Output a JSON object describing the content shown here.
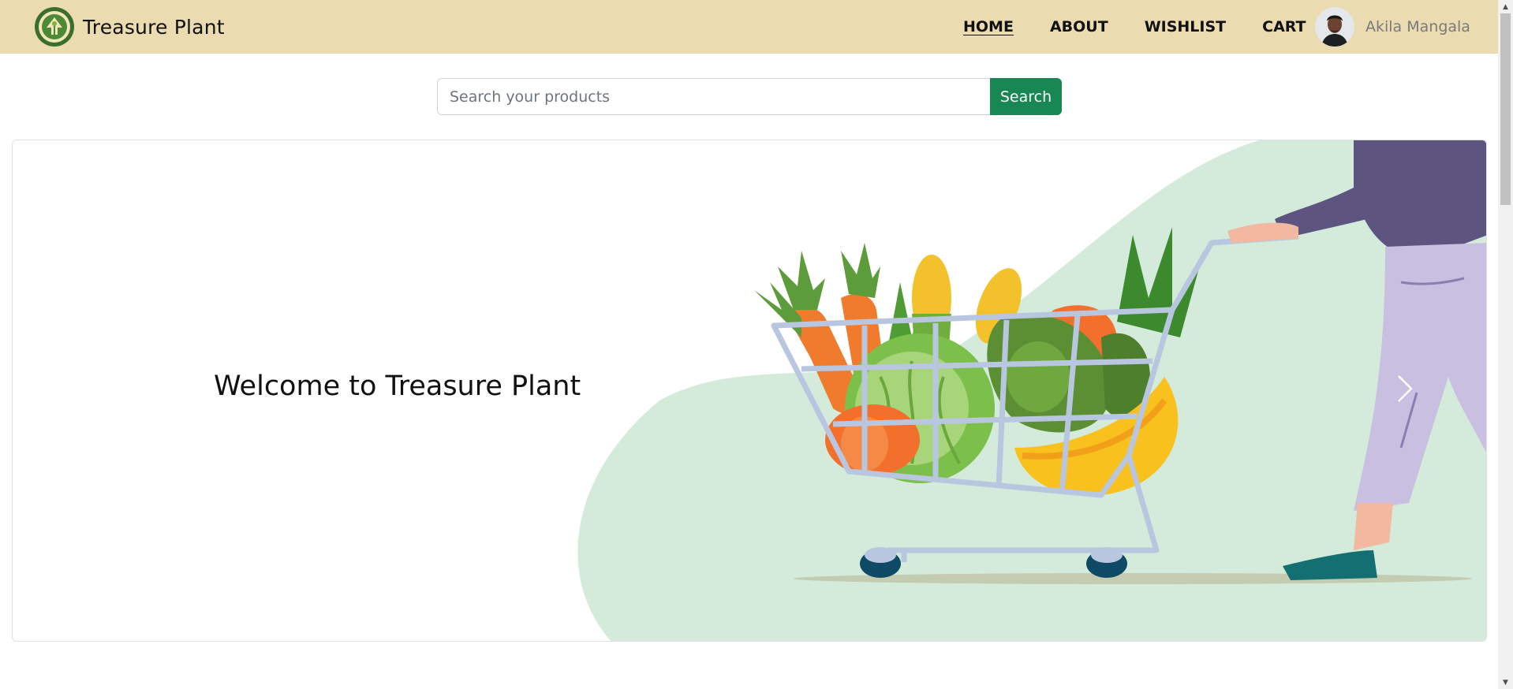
{
  "brand": {
    "name": "Treasure Plant",
    "logo_icon": "treasure-plant-logo-icon"
  },
  "nav": {
    "links": [
      {
        "label": "HOME",
        "active": true
      },
      {
        "label": "ABOUT",
        "active": false
      },
      {
        "label": "WISHLIST",
        "active": false
      },
      {
        "label": "CART",
        "active": false
      }
    ]
  },
  "user": {
    "name": "Akila Mangala",
    "avatar_icon": "user-avatar"
  },
  "search": {
    "placeholder": "Search your products",
    "button_label": "Search"
  },
  "carousel": {
    "slide_title": "Welcome to Treasure Plant",
    "next_icon": "chevron-right-icon"
  },
  "colors": {
    "navbar_bg": "#ebdbb0",
    "search_button": "#198754",
    "hero_blob": "#d4ebdc"
  }
}
